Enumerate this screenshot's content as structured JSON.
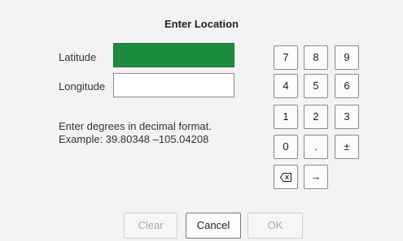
{
  "dialog": {
    "title": "Enter Location",
    "latitude": {
      "label": "Latitude",
      "value": "",
      "focused": true
    },
    "longitude": {
      "label": "Longitude",
      "value": ""
    },
    "hint": {
      "line1": "Enter degrees in decimal format.",
      "line2": "Example:  39.80348  –105.04208"
    }
  },
  "keypad": {
    "k7": "7",
    "k8": "8",
    "k9": "9",
    "k4": "4",
    "k5": "5",
    "k6": "6",
    "k1": "1",
    "k2": "2",
    "k3": "3",
    "k0": "0",
    "dot": ".",
    "sign": "±",
    "backspace_icon": "backspace-icon",
    "next_symbol": "→"
  },
  "buttons": {
    "clear": "Clear",
    "cancel": "Cancel",
    "ok": "OK"
  },
  "colors": {
    "focus_field": "#1e8c3e"
  }
}
